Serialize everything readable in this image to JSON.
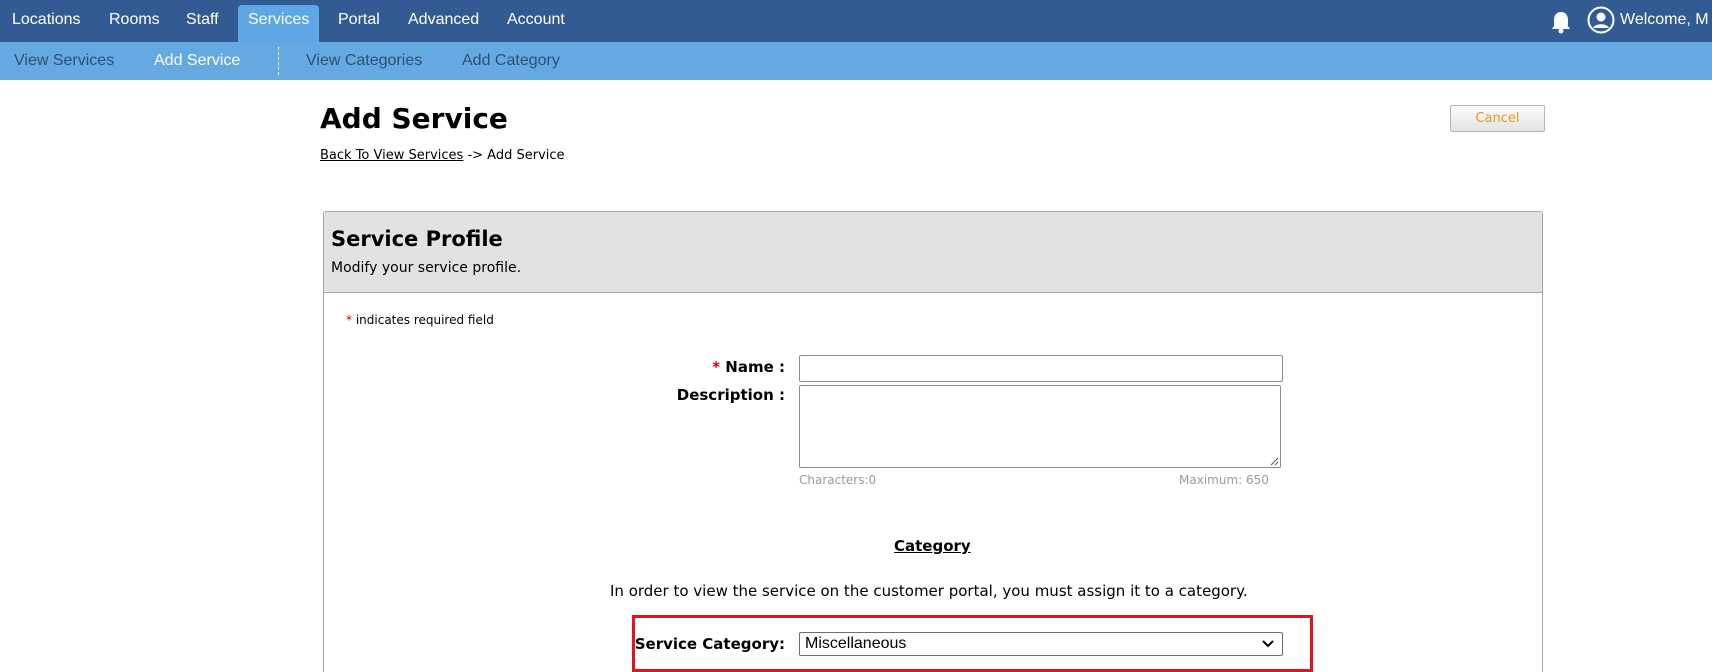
{
  "topnav": {
    "items": [
      "Locations",
      "Rooms",
      "Staff",
      "Services",
      "Portal",
      "Advanced",
      "Account"
    ],
    "active": "Services",
    "welcome": "Welcome, M"
  },
  "subnav": {
    "items": [
      "View Services",
      "Add Service",
      "View Categories",
      "Add Category"
    ],
    "active": "Add Service"
  },
  "page": {
    "title": "Add Service",
    "breadcrumb_link": "Back To View Services",
    "breadcrumb_current": "-> Add Service",
    "cancel_label": "Cancel"
  },
  "panel": {
    "title": "Service Profile",
    "subtitle": "Modify your service profile.",
    "required_mark": "*",
    "required_note": "indicates required field",
    "name_label": "Name :",
    "name_value": "",
    "description_label": "Description :",
    "description_value": "",
    "chars_label": "Characters:0",
    "max_label": "Maximum: 650",
    "category_heading": "Category",
    "category_text": "In order to view the service on the customer portal, you must assign it to a category.",
    "service_category_label": "Service Category:",
    "service_category_value": "Miscellaneous"
  },
  "colors": {
    "topnav_bg": "#325b94",
    "subnav_bg": "#65a9e3",
    "highlight": "#e0141a",
    "required": "#d40000"
  }
}
